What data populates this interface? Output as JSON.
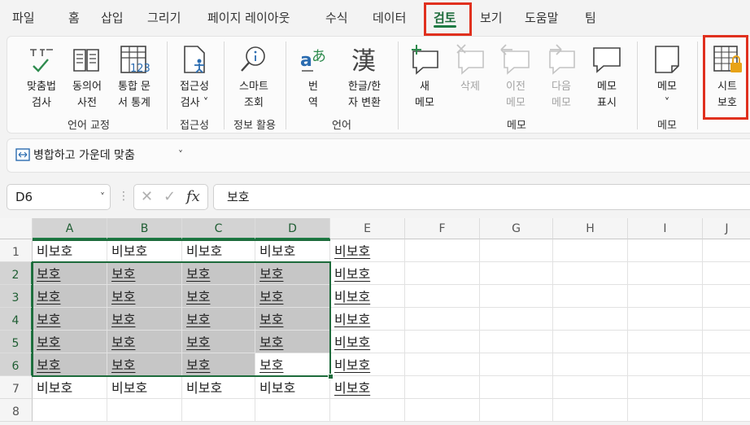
{
  "tabs": [
    "파일",
    "홈",
    "삽입",
    "그리기",
    "페이지 레이아웃",
    "수식",
    "데이터",
    "검토",
    "보기",
    "도움말",
    "팀"
  ],
  "active_tab": "검토",
  "ribbon": {
    "buttons": {
      "spelling": "맞춤법\n검사",
      "thesaurus": "동의어\n사전",
      "workbook_stats": "통합 문\n서 통계",
      "check_accessibility": "접근성\n검사 ˅",
      "smart_lookup": "스마트\n조회",
      "translate": "번\n역",
      "hangul_hanja": "한글/한\n자 변환",
      "new_comment": "새\n메모",
      "delete": "삭제",
      "previous": "이전\n메모",
      "next": "다음\n메모",
      "show_comments": "메모\n표시",
      "notes": "메모\n˅",
      "protect_sheet": "시트\n보호"
    },
    "groups": {
      "proofing": "언어 교정",
      "accessibility": "접근성",
      "insights": "정보 활용",
      "language": "언어",
      "comments": "메모",
      "notes": "메모"
    }
  },
  "quickbar": {
    "merge_center": "병합하고 가운데 맞춤",
    "dropdown": "˅"
  },
  "formula_bar": {
    "name_box": "D6",
    "name_dropdown": "˅",
    "cancel": "✕",
    "enter": "✓",
    "fx": "fx",
    "content": "보호"
  },
  "grid": {
    "columns": [
      "A",
      "B",
      "C",
      "D",
      "E",
      "F",
      "G",
      "H",
      "I",
      "J"
    ],
    "rows": [
      "1",
      "2",
      "3",
      "4",
      "5",
      "6",
      "7",
      "8"
    ],
    "cells": [
      [
        "비보호",
        "비보호",
        "비보호",
        "비보호",
        "비보호"
      ],
      [
        "보호",
        "보호",
        "보호",
        "보호",
        "비보호"
      ],
      [
        "보호",
        "보호",
        "보호",
        "보호",
        "비보호"
      ],
      [
        "보호",
        "보호",
        "보호",
        "보호",
        "비보호"
      ],
      [
        "보호",
        "보호",
        "보호",
        "보호",
        "비보호"
      ],
      [
        "보호",
        "보호",
        "보호",
        "보호",
        "비보호"
      ],
      [
        "비보호",
        "비보호",
        "비보호",
        "비보호",
        "비보호"
      ]
    ]
  },
  "colors": {
    "accent": "#1d7a43",
    "highlight": "#e0301e",
    "selection_fill": "#c6c6c6"
  }
}
